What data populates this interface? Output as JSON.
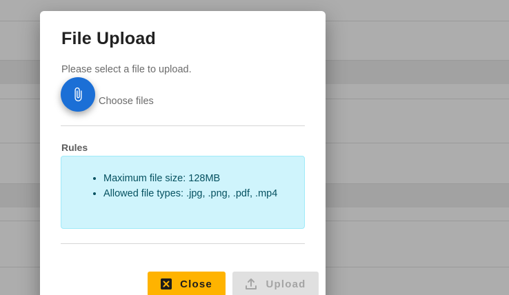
{
  "dialog": {
    "title": "File Upload",
    "prompt": "Please select a file to upload.",
    "choose_label": "Choose files",
    "rules_heading": "Rules",
    "rules": [
      "Maximum file size: 128MB",
      "Allowed file types: .jpg, .png, .pdf, .mp4"
    ],
    "close_label": "Close",
    "upload_label": "Upload",
    "upload_disabled": true
  },
  "icons": {
    "attach": "paperclip-icon",
    "close": "close-box-icon",
    "upload": "upload-icon"
  },
  "colors": {
    "primary": "#1b6fd6",
    "close_button": "#ffb300",
    "info_bg": "#cff4fc",
    "info_text": "#055160"
  }
}
